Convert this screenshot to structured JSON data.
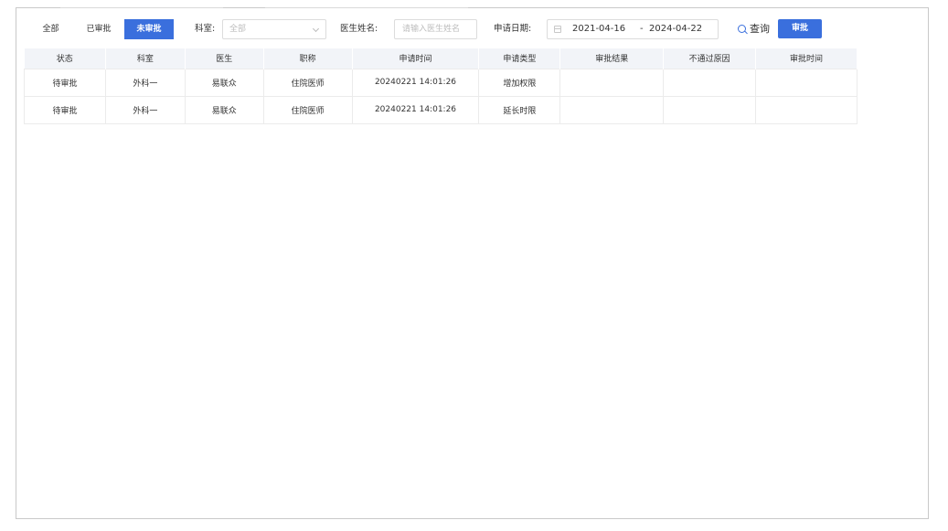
{
  "tabs": [
    {
      "label": "全部",
      "active": false
    },
    {
      "label": "已审批",
      "active": false
    },
    {
      "label": "未审批",
      "active": true
    }
  ],
  "filters": {
    "department_label": "科室:",
    "department_value": "全部",
    "doctor_label": "医生姓名:",
    "doctor_placeholder": "请输入医生姓名",
    "date_label": "申请日期:",
    "date_start": "2021-04-16",
    "date_sep": "-",
    "date_end": "2024-04-22",
    "query_label": "查询",
    "approve_label": "审批"
  },
  "colors": {
    "accent": "#3a6fdd",
    "header_bg": "#f2f4f8"
  },
  "table": {
    "columns": [
      "状态",
      "科室",
      "医生",
      "职称",
      "申请时间",
      "申请类型",
      "审批结果",
      "不通过原因",
      "审批时间"
    ],
    "rows": [
      [
        "待审批",
        "外科一",
        "易联众",
        "住院医师",
        "20240221 14:01:26",
        "增加权限",
        "",
        "",
        ""
      ],
      [
        "待审批",
        "外科一",
        "易联众",
        "住院医师",
        "20240221 14:01:26",
        "延长时限",
        "",
        "",
        ""
      ]
    ]
  }
}
